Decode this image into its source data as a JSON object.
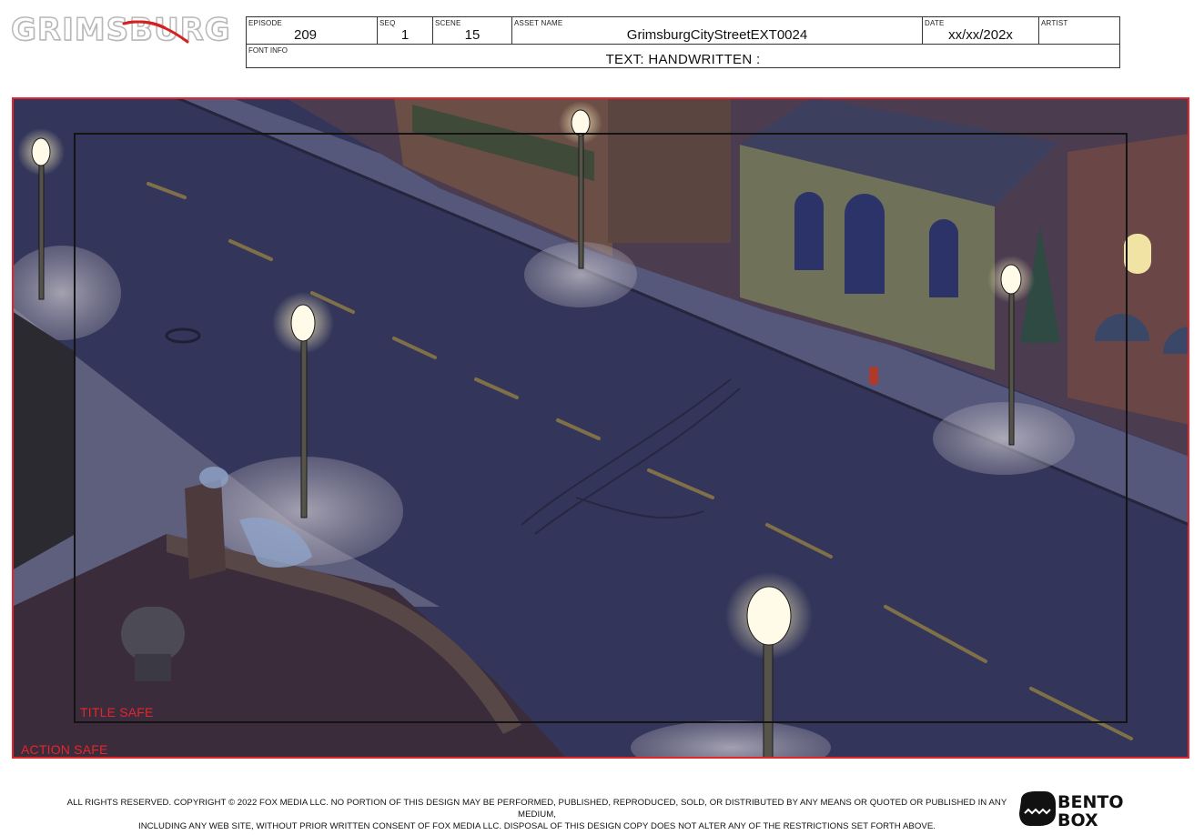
{
  "header": {
    "logo_text": "GRIMSBURG",
    "fields": {
      "episode": {
        "label": "EPISODE",
        "value": "209"
      },
      "seq": {
        "label": "SEQ",
        "value": "1"
      },
      "scene": {
        "label": "SCENE",
        "value": "15"
      },
      "asset_name": {
        "label": "ASSET NAME",
        "value": "GrimsburgCityStreetEXT0024"
      },
      "date": {
        "label": "DATE",
        "value": "xx/xx/202x"
      },
      "artist": {
        "label": "ARTIST",
        "value": ""
      }
    },
    "font_info": {
      "label": "FONT INFO",
      "value": "TEXT: HANDWRITTEN :"
    }
  },
  "frame": {
    "title_safe_label": "TITLE SAFE",
    "action_safe_label": "ACTION SAFE",
    "action_safe_color": "#e3262e",
    "title_safe_color": "#141414"
  },
  "footer": {
    "legal_line1": "ALL RIGHTS RESERVED. COPYRIGHT © 2022 FOX MEDIA LLC. NO PORTION OF THIS DESIGN MAY BE PERFORMED, PUBLISHED, REPRODUCED, SOLD, OR DISTRIBUTED BY ANY MEANS OR QUOTED OR PUBLISHED IN ANY MEDIUM,",
    "legal_line2": "INCLUDING ANY WEB SITE, WITHOUT PRIOR WRITTEN CONSENT OF FOX MEDIA LLC. DISPOSAL OF THIS DESIGN COPY DOES NOT ALTER ANY OF THE RESTRICTIONS SET FORTH ABOVE.",
    "studio_logo": "BENTO BOX"
  },
  "colors": {
    "night_sky": "#2b2d4a",
    "street": "#3a3d5e",
    "lamp_glow": "#fff6d8"
  }
}
